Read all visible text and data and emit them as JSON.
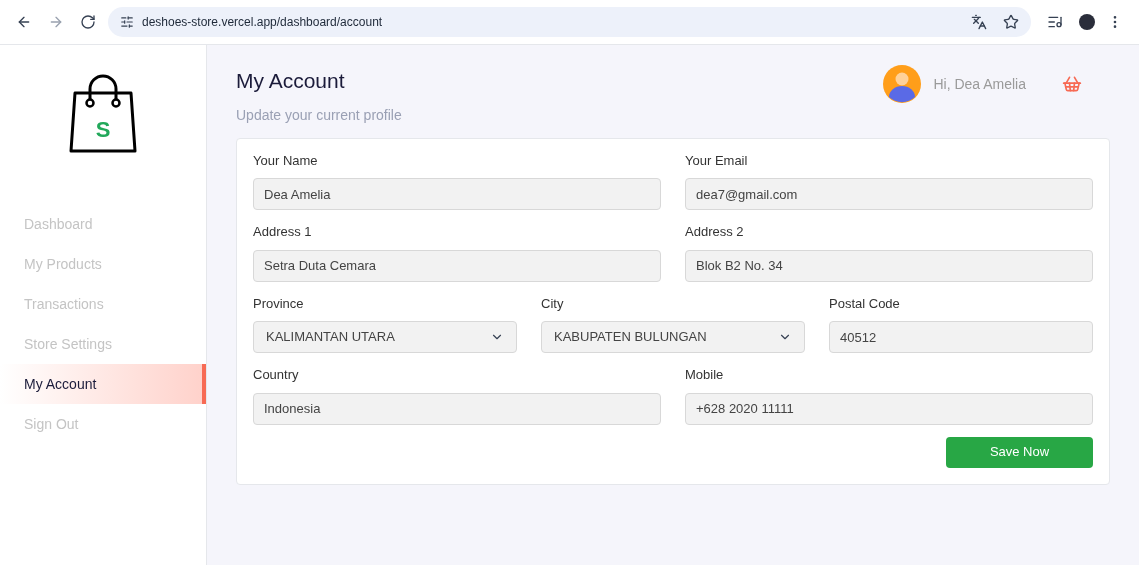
{
  "browser": {
    "url": "deshoes-store.vercel.app/dashboard/account"
  },
  "sidebar": {
    "items": [
      {
        "label": "Dashboard",
        "selected": false
      },
      {
        "label": "My Products",
        "selected": false
      },
      {
        "label": "Transactions",
        "selected": false
      },
      {
        "label": "Store Settings",
        "selected": false
      },
      {
        "label": "My Account",
        "selected": true
      },
      {
        "label": "Sign Out",
        "selected": false
      }
    ]
  },
  "logo": {
    "letter": "S"
  },
  "header": {
    "title": "My Account",
    "subtitle": "Update your current profile",
    "greeting": "Hi, Dea Amelia"
  },
  "form": {
    "rows": [
      [
        {
          "label": "Your Name",
          "value": "Dea Amelia",
          "kind": "text"
        },
        {
          "label": "Your Email",
          "value": "dea7@gmail.com",
          "kind": "text"
        }
      ],
      [
        {
          "label": "Address 1",
          "value": "Setra Duta Cemara",
          "kind": "text"
        },
        {
          "label": "Address 2",
          "value": "Blok B2 No. 34",
          "kind": "text"
        }
      ],
      [
        {
          "label": "Province",
          "value": "KALIMANTAN UTARA",
          "kind": "select"
        },
        {
          "label": "City",
          "value": "KABUPATEN BULUNGAN",
          "kind": "select"
        },
        {
          "label": "Postal Code",
          "value": "40512",
          "kind": "text"
        }
      ],
      [
        {
          "label": "Country",
          "value": "Indonesia",
          "kind": "text"
        },
        {
          "label": "Mobile",
          "value": "+628 2020 11111",
          "kind": "text"
        }
      ]
    ],
    "submit": "Save Now"
  }
}
